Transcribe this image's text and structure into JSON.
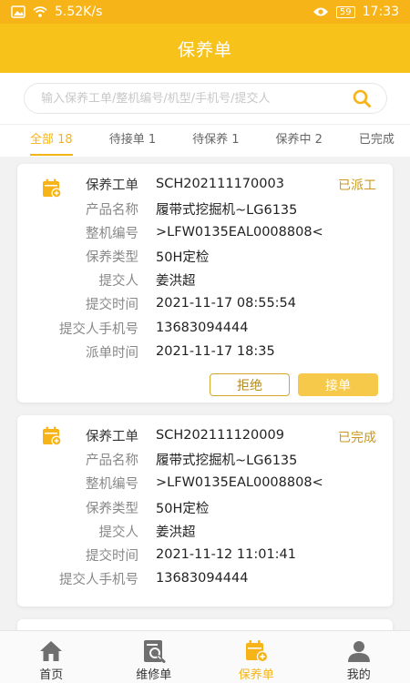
{
  "status_bar": {
    "network": "5.52K/s",
    "battery": "59",
    "time": "17:33"
  },
  "header": {
    "title": "保养单"
  },
  "search": {
    "placeholder": "输入保养工单/整机编号/机型/手机号/提交人"
  },
  "tabs": [
    {
      "label": "全部 18",
      "active": true
    },
    {
      "label": "待接单 1"
    },
    {
      "label": "待保养 1"
    },
    {
      "label": "保养中 2"
    },
    {
      "label": "已完成"
    }
  ],
  "orders": [
    {
      "status": "已派工",
      "fields": [
        {
          "label": "保养工单",
          "value": "SCH202111170003"
        },
        {
          "label": "产品名称",
          "value": "履带式挖掘机~LG6135"
        },
        {
          "label": "整机编号",
          "value": ">LFW0135EAL0008808<"
        },
        {
          "label": "保养类型",
          "value": "50H定检"
        },
        {
          "label": "提交人",
          "value": "姜洪超"
        },
        {
          "label": "提交时间",
          "value": "2021-11-17 08:55:54"
        },
        {
          "label": "提交人手机号",
          "value": "13683094444"
        },
        {
          "label": "派单时间",
          "value": "2021-11-17 18:35"
        }
      ],
      "reject_label": "拒绝",
      "accept_label": "接单"
    },
    {
      "status": "已完成",
      "fields": [
        {
          "label": "保养工单",
          "value": "SCH202111120009"
        },
        {
          "label": "产品名称",
          "value": "履带式挖掘机~LG6135"
        },
        {
          "label": "整机编号",
          "value": ">LFW0135EAL0008808<"
        },
        {
          "label": "保养类型",
          "value": "50H定检"
        },
        {
          "label": "提交人",
          "value": "姜洪超"
        },
        {
          "label": "提交时间",
          "value": "2021-11-12 11:01:41"
        },
        {
          "label": "提交人手机号",
          "value": "13683094444"
        }
      ]
    }
  ],
  "bottom_nav": [
    {
      "label": "首页",
      "icon": "home-icon"
    },
    {
      "label": "维修单",
      "icon": "repair-order-icon"
    },
    {
      "label": "保养单",
      "icon": "maintenance-order-icon",
      "active": true
    },
    {
      "label": "我的",
      "icon": "user-icon"
    }
  ],
  "colors": {
    "brand": "#f7c21a",
    "accent": "#f6b419",
    "status_text": "#c9981d"
  }
}
